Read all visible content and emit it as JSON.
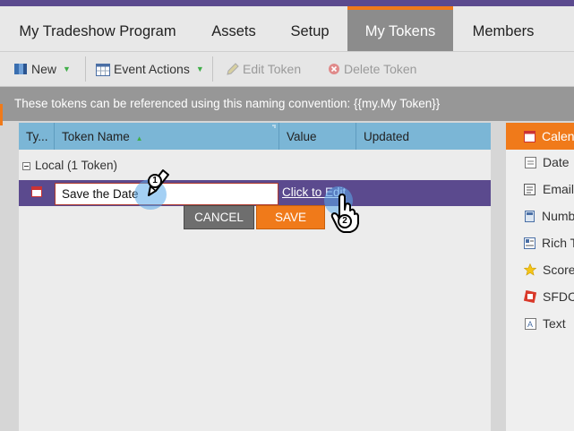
{
  "tabs": [
    {
      "label": "My Tradeshow Program",
      "active": false
    },
    {
      "label": "Assets",
      "active": false
    },
    {
      "label": "Setup",
      "active": false
    },
    {
      "label": "My Tokens",
      "active": true
    },
    {
      "label": "Members",
      "active": false
    }
  ],
  "toolbar": {
    "new_label": "New",
    "event_actions_label": "Event Actions",
    "edit_token_label": "Edit Token",
    "delete_token_label": "Delete Token"
  },
  "info": {
    "text": "These tokens can be referenced using this naming convention: {{my.My Token}}"
  },
  "grid": {
    "columns": [
      "Ty...",
      "Token Name",
      "Value",
      "Updated"
    ],
    "sort_indicator": "▲",
    "group_label": "Local (1 Token)",
    "row": {
      "name_value": "Save the Date",
      "value_prefix": "Click to ",
      "value_link": "Edit"
    },
    "cancel_label": "CANCEL",
    "save_label": "SAVE"
  },
  "side": {
    "items": [
      {
        "label": "Calen",
        "icon": "calendar-icon",
        "active": true
      },
      {
        "label": "Date",
        "icon": "date-icon",
        "active": false
      },
      {
        "label": "Email",
        "icon": "email-icon",
        "active": false
      },
      {
        "label": "Numb",
        "icon": "number-icon",
        "active": false
      },
      {
        "label": "Rich T",
        "icon": "rich-text-icon",
        "active": false
      },
      {
        "label": "Score",
        "icon": "score-icon",
        "active": false
      },
      {
        "label": "SFDC",
        "icon": "sfdc-icon",
        "active": false
      },
      {
        "label": "Text",
        "icon": "text-icon",
        "active": false
      }
    ]
  },
  "annotations": {
    "step1": "1",
    "step2": "2"
  },
  "colors": {
    "brand_purple": "#5b4a8e",
    "accent_orange": "#f07a1a",
    "header_blue": "#7bb6d6"
  }
}
